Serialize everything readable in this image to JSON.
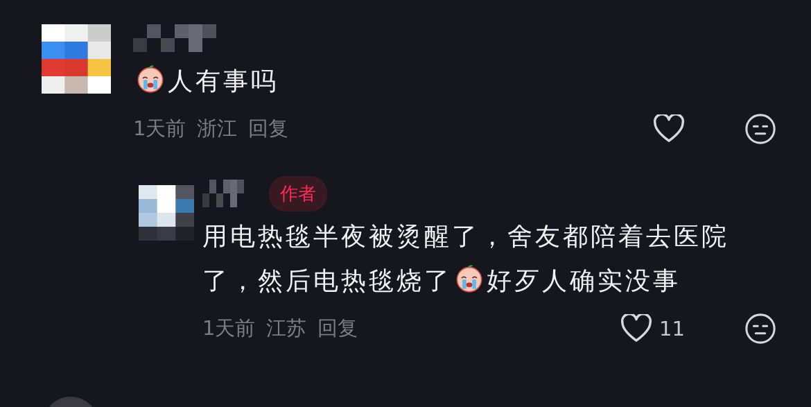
{
  "comments": [
    {
      "content": [
        {
          "kind": "emoji"
        },
        {
          "kind": "text",
          "text": "人有事吗"
        }
      ],
      "time": "1天前",
      "location": "浙江",
      "reply": "回复",
      "liked": false,
      "replies": [
        {
          "author_badge": "作者",
          "content": [
            {
              "kind": "text",
              "text": "用电热毯半夜被烫醒了，舍友都陪着去医院"
            },
            {
              "kind": "text",
              "text": "了，然后电热毯烧了"
            },
            {
              "kind": "emoji"
            },
            {
              "kind": "text",
              "text": "好歹人确实没事"
            }
          ],
          "time": "1天前",
          "location": "江苏",
          "reply": "回复",
          "liked": false,
          "likes": "11"
        }
      ]
    }
  ]
}
